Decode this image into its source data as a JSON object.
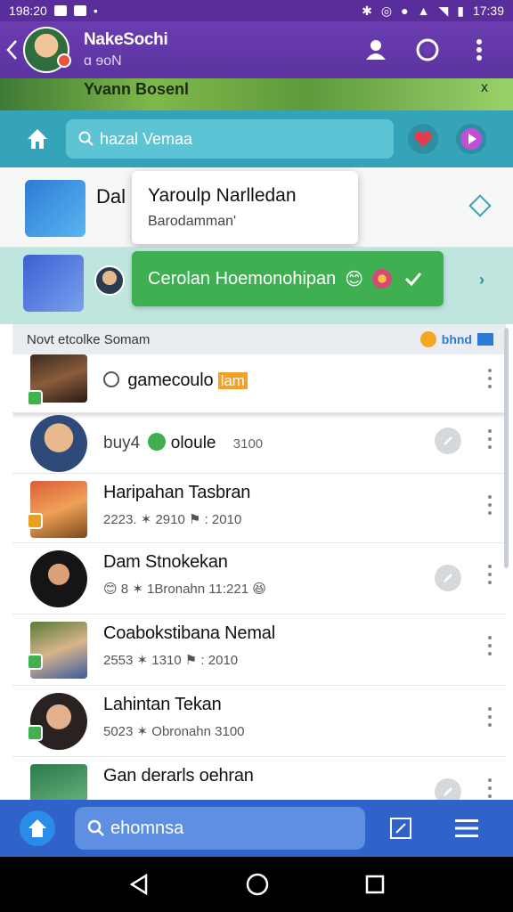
{
  "status_bar": {
    "time_left": "198:20",
    "time_right": "17:39"
  },
  "header": {
    "title": "NakeSochi",
    "subtitle": "ɑ ɘоΝ"
  },
  "banner": {
    "text": "Yvann Bosenl",
    "close": "x"
  },
  "search": {
    "placeholder": "hazal Vemaa"
  },
  "card1": {
    "name_partial": "Dal",
    "tooltip_title": "Yaroulp Narlledan",
    "tooltip_sub": "Barodamman'"
  },
  "toast": {
    "text": "Cerolan Hoemonohipan",
    "emoji": "😊"
  },
  "section": {
    "title": "Novt etcolke Somam",
    "right": "bhnd"
  },
  "list": [
    {
      "name": "gamecoulo",
      "tag": "lam",
      "selected": true
    },
    {
      "name": "buy4",
      "meta": "oloule",
      "time": "3100",
      "selected": false
    },
    {
      "name": "Haripahan Tasbran",
      "sub": "2223.  ✶ 2910  ⚑  :  2010"
    },
    {
      "name": "Dam Stnokekan",
      "sub": "😊 8  ✶ 1Bronahn    11:221 😆"
    },
    {
      "name": "Coabokstibana Nemal",
      "sub": "2553  ✶ 1310  ⚑  :  2010"
    },
    {
      "name": "Lahintan Tekan",
      "sub": "5023  ✶ Obronahn    3100"
    },
    {
      "name": "Gan derarls oehran",
      "sub": ""
    }
  ],
  "bottom": {
    "search_text": "ehomnsa"
  },
  "colors": {
    "header": "#6b3db0",
    "search_row": "#35a3b8",
    "toast": "#3eb052",
    "bottom": "#2f63c9"
  }
}
